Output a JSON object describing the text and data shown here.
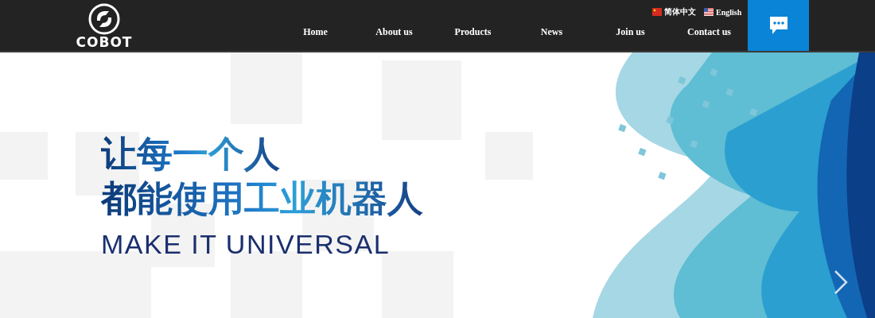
{
  "header": {
    "logo_text": "COBOT",
    "nav": [
      {
        "label": "Home"
      },
      {
        "label": "About us"
      },
      {
        "label": "Products"
      },
      {
        "label": "News"
      },
      {
        "label": "Join us"
      },
      {
        "label": "Contact us"
      }
    ],
    "languages": [
      {
        "label": "简体中文",
        "kind": "cn"
      },
      {
        "label": "English",
        "kind": "us"
      }
    ]
  },
  "hero": {
    "headline": [
      "让每一个人",
      "都能使用工业机器人"
    ],
    "subtitle": "MAKE IT UNIVERSAL"
  }
}
